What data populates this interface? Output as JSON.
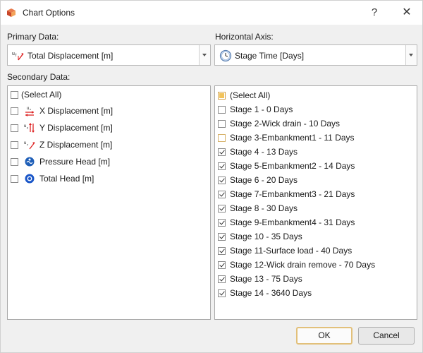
{
  "window": {
    "title": "Chart Options",
    "help_label": "?",
    "close_label": "✕"
  },
  "primary": {
    "label": "Primary Data:",
    "value": "Total Displacement [m]",
    "icon": "total-displacement-icon"
  },
  "horizontal": {
    "label": "Horizontal Axis:",
    "value": "Stage Time [Days]",
    "icon": "clock-icon"
  },
  "secondary": {
    "label": "Secondary Data:",
    "items": [
      {
        "label": "(Select All)",
        "checked": false,
        "icon": ""
      },
      {
        "label": "X Displacement [m]",
        "checked": false,
        "icon": "x-displacement-icon"
      },
      {
        "label": "Y Displacement [m]",
        "checked": false,
        "icon": "y-displacement-icon"
      },
      {
        "label": "Z Displacement [m]",
        "checked": false,
        "icon": "z-displacement-icon"
      },
      {
        "label": "Pressure Head [m]",
        "checked": false,
        "icon": "pressure-head-icon"
      },
      {
        "label": "Total Head [m]",
        "checked": false,
        "icon": "total-head-icon"
      }
    ]
  },
  "stages": {
    "items": [
      {
        "label": "(Select All)",
        "state": "partial"
      },
      {
        "label": "Stage 1 - 0 Days",
        "state": "unchecked"
      },
      {
        "label": "Stage 2-Wick drain - 10 Days",
        "state": "unchecked"
      },
      {
        "label": "Stage 3-Embankment1 - 11 Days",
        "state": "highlight"
      },
      {
        "label": "Stage 4 - 13 Days",
        "state": "checked"
      },
      {
        "label": "Stage 5-Embankment2 - 14 Days",
        "state": "checked"
      },
      {
        "label": "Stage 6 - 20 Days",
        "state": "checked"
      },
      {
        "label": "Stage 7-Embankment3 - 21 Days",
        "state": "checked"
      },
      {
        "label": "Stage 8 - 30 Days",
        "state": "checked"
      },
      {
        "label": "Stage 9-Embankment4 - 31 Days",
        "state": "checked"
      },
      {
        "label": "Stage 10 - 35 Days",
        "state": "checked"
      },
      {
        "label": "Stage 11-Surface load - 40 Days",
        "state": "checked"
      },
      {
        "label": "Stage 12-Wick drain remove - 70 Days",
        "state": "checked"
      },
      {
        "label": "Stage 13 - 75 Days",
        "state": "checked"
      },
      {
        "label": "Stage 14 - 3640 Days",
        "state": "checked"
      }
    ]
  },
  "buttons": {
    "ok": "OK",
    "cancel": "Cancel"
  }
}
